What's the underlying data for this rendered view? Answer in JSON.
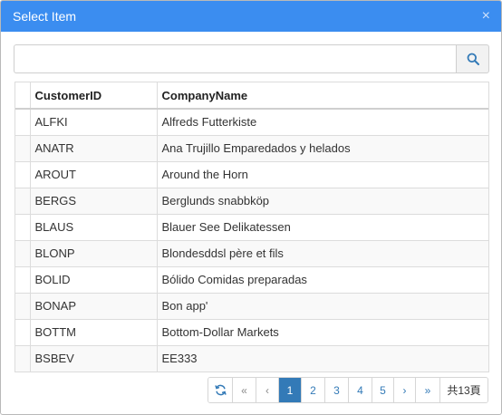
{
  "dialog": {
    "title": "Select Item",
    "close_glyph": "×"
  },
  "search": {
    "value": "",
    "placeholder": "",
    "button_icon": "search-icon"
  },
  "table": {
    "columns": [
      "",
      "CustomerID",
      "CompanyName"
    ],
    "rows": [
      {
        "id": "ALFKI",
        "name": "Alfreds Futterkiste"
      },
      {
        "id": "ANATR",
        "name": "Ana Trujillo Emparedados y helados"
      },
      {
        "id": "AROUT",
        "name": "Around the Horn"
      },
      {
        "id": "BERGS",
        "name": "Berglunds snabbköp"
      },
      {
        "id": "BLAUS",
        "name": "Blauer See Delikatessen"
      },
      {
        "id": "BLONP",
        "name": "Blondesddsl père et fils"
      },
      {
        "id": "BOLID",
        "name": "Bólido Comidas preparadas"
      },
      {
        "id": "BONAP",
        "name": "Bon app'"
      },
      {
        "id": "BOTTM",
        "name": "Bottom-Dollar Markets"
      },
      {
        "id": "BSBEV",
        "name": "EE333"
      }
    ]
  },
  "pager": {
    "refresh_icon": "refresh-icon",
    "first": "«",
    "prev": "‹",
    "pages": [
      "1",
      "2",
      "3",
      "4",
      "5"
    ],
    "current_page": "1",
    "next": "›",
    "last": "»",
    "total_label": "共13頁"
  },
  "colors": {
    "titlebar": "#3b8df0",
    "accent": "#337ab7"
  }
}
